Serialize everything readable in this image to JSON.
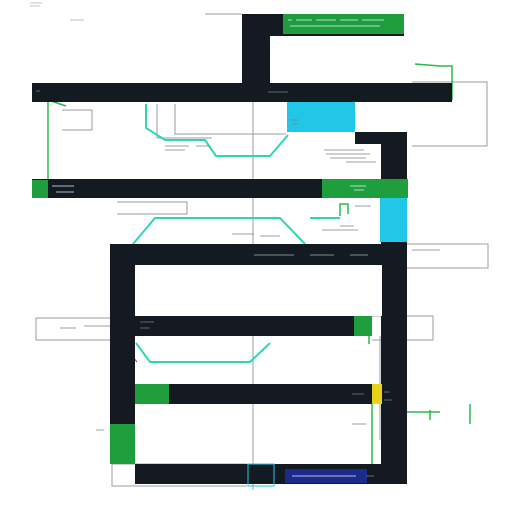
{
  "colors": {
    "bar": "#141a22",
    "green": "#1e9e3c",
    "cyan": "#22c6e6",
    "teal_trace": "#2fd6b4",
    "yellow": "#e8d21a",
    "navy": "#1c2a8c",
    "line": "#9a9fa4"
  }
}
